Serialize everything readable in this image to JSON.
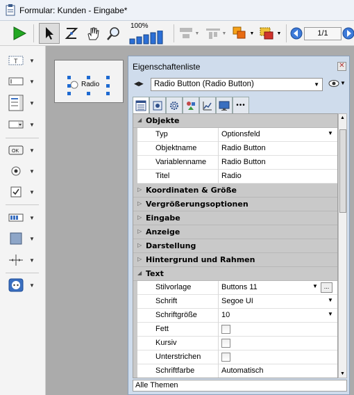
{
  "window": {
    "title": "Formular: Kunden -  Eingabe*"
  },
  "toolbar": {
    "zoom_label": "100%",
    "page_indicator": "1/1"
  },
  "form": {
    "radio_label": "Radio"
  },
  "panel": {
    "title": "Eigenschaftenliste",
    "object_selector": "Radio Button (Radio Button)",
    "footer": "Alle Themen",
    "sections": {
      "objekte": "Objekte",
      "koordinaten": "Koordinaten & Größe",
      "vergroesserung": "Vergrößerungsoptionen",
      "eingabe": "Eingabe",
      "anzeige": "Anzeige",
      "darstellung": "Darstellung",
      "hintergrund": "Hintergrund und Rahmen",
      "text": "Text"
    },
    "props": {
      "typ": {
        "name": "Typ",
        "value": "Optionsfeld"
      },
      "objektname": {
        "name": "Objektname",
        "value": "Radio Button"
      },
      "variablenname": {
        "name": "Variablenname",
        "value": "Radio Button"
      },
      "titel": {
        "name": "Titel",
        "value": "Radio"
      },
      "stilvorlage": {
        "name": "Stilvorlage",
        "value": "Buttons 11"
      },
      "schrift": {
        "name": "Schrift",
        "value": "Segoe UI"
      },
      "schriftgroesse": {
        "name": "Schriftgröße",
        "value": "10"
      },
      "fett": {
        "name": "Fett"
      },
      "kursiv": {
        "name": "Kursiv"
      },
      "unterstrichen": {
        "name": "Unterstrichen"
      },
      "schriftfarbe": {
        "name": "Schriftfarbe",
        "value": "Automatisch"
      }
    },
    "ellipsis": "..."
  }
}
